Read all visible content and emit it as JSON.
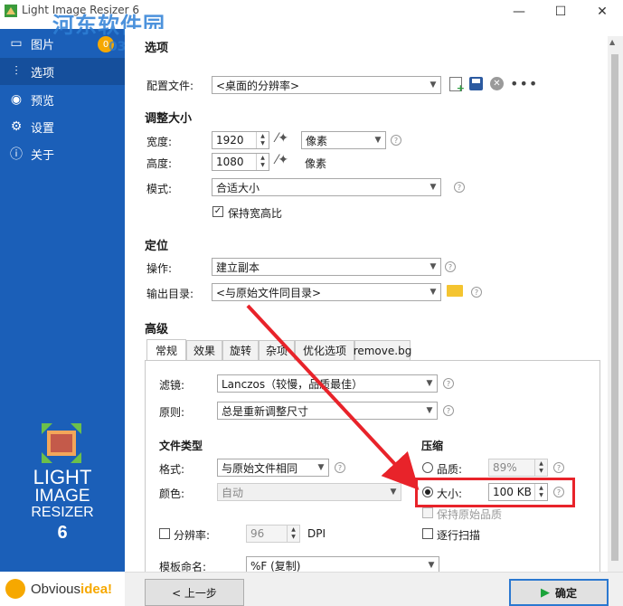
{
  "window": {
    "title": "Light Image Resizer 6",
    "controls": {
      "minimize": "—",
      "maximize": "☐",
      "close": "✕"
    }
  },
  "watermark": {
    "text": "河东软件园",
    "sub": "0359"
  },
  "sidebar": {
    "items": [
      {
        "label": "图片",
        "icon": "image-icon"
      },
      {
        "label": "选项",
        "icon": "sliders-icon"
      },
      {
        "label": "预览",
        "icon": "eye-icon"
      },
      {
        "label": "设置",
        "icon": "gear-icon"
      },
      {
        "label": "关于",
        "icon": "info-icon"
      }
    ],
    "badge": "0",
    "logo": {
      "line1": "LIGHT",
      "line2": "IMAGE",
      "line3": "RESIZER",
      "line4": "6"
    },
    "brand": {
      "part1": "Obvious",
      "part2": "idea!"
    }
  },
  "main": {
    "title": "选项",
    "profile": {
      "label": "配置文件:",
      "value": "<桌面的分辨率>"
    },
    "resize": {
      "heading": "调整大小",
      "width_label": "宽度:",
      "width_value": "1920",
      "height_label": "高度:",
      "height_value": "1080",
      "unit_value": "像素",
      "unit_static": "像素",
      "mode_label": "模式:",
      "mode_value": "合适大小",
      "keep_ratio_label": "保持宽高比"
    },
    "position": {
      "heading": "定位",
      "operation_label": "操作:",
      "operation_value": "建立副本",
      "output_label": "输出目录:",
      "output_value": "<与原始文件同目录>"
    },
    "advanced": {
      "heading": "高级",
      "tabs": [
        "常规",
        "效果",
        "旋转",
        "杂项",
        "优化选项",
        "remove.bg"
      ],
      "filter_label": "滤镜:",
      "filter_value": "Lanczos（较慢，品质最佳）",
      "rule_label": "原则:",
      "rule_value": "总是重新调整尺寸",
      "filetype_heading": "文件类型",
      "format_label": "格式:",
      "format_value": "与原始文件相同",
      "color_label": "颜色:",
      "color_value": "自动",
      "compression_heading": "压缩",
      "quality_label": "品质:",
      "quality_value": "89%",
      "size_label": "大小:",
      "size_value": "100 KB",
      "keep_quality_label": "保持原始品质",
      "progressive_label": "逐行扫描",
      "resolution_label": "分辨率:",
      "resolution_value": "96",
      "resolution_unit": "DPI",
      "template_label": "模板命名:",
      "template_value": "%F (复制)"
    }
  },
  "footer": {
    "back_label": "< 上一步",
    "ok_label": "确定"
  },
  "colors": {
    "sidebar": "#1b5fb8",
    "highlight": "#e8232a",
    "accent": "#2b78d0"
  }
}
